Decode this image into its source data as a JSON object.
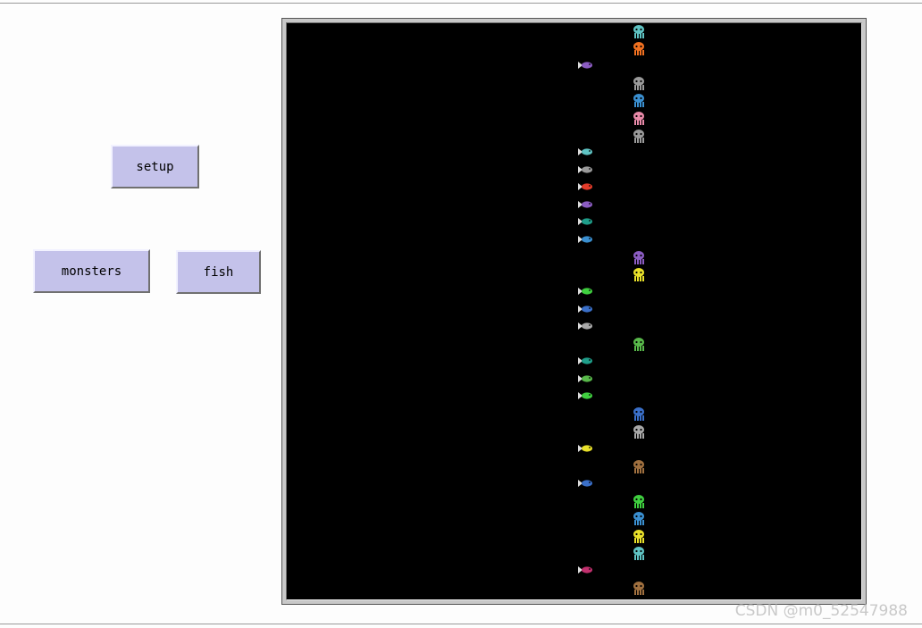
{
  "buttons": {
    "setup": "setup",
    "monsters": "monsters",
    "fish": "fish"
  },
  "world": {
    "background": "#000000",
    "fish": [
      {
        "color": "#8b5cc2"
      },
      {
        "color": "#5fc3c3"
      },
      {
        "color": "#9a9a9a"
      },
      {
        "color": "#e23b2a"
      },
      {
        "color": "#8b5cc2"
      },
      {
        "color": "#1f9e8a"
      },
      {
        "color": "#3a8fd0"
      },
      {
        "color": "#3fcf3f"
      },
      {
        "color": "#3a6fc8"
      },
      {
        "color": "#a8a8a8"
      },
      {
        "color": "#1f9e8a"
      },
      {
        "color": "#58b84a"
      },
      {
        "color": "#3fcf3f"
      },
      {
        "color": "#e8e02a"
      },
      {
        "color": "#3a6fc8"
      },
      {
        "color": "#c2306e"
      }
    ],
    "monsters": [
      {
        "color": "#5fc3c3"
      },
      {
        "color": "#f07020"
      },
      {
        "color": "#9a9a9a"
      },
      {
        "color": "#3a8fd0"
      },
      {
        "color": "#e889a8"
      },
      {
        "color": "#9a9a9a"
      },
      {
        "color": "#8b5cc2"
      },
      {
        "color": "#e8e02a"
      },
      {
        "color": "#58b84a"
      },
      {
        "color": "#3a6fc8"
      },
      {
        "color": "#a8a8a8"
      },
      {
        "color": "#a0703f"
      },
      {
        "color": "#3fcf3f"
      },
      {
        "color": "#3a8fd0"
      },
      {
        "color": "#e8e02a"
      },
      {
        "color": "#5fc3c3"
      },
      {
        "color": "#a0703f"
      }
    ]
  },
  "watermark": "CSDN @m0_52547988"
}
